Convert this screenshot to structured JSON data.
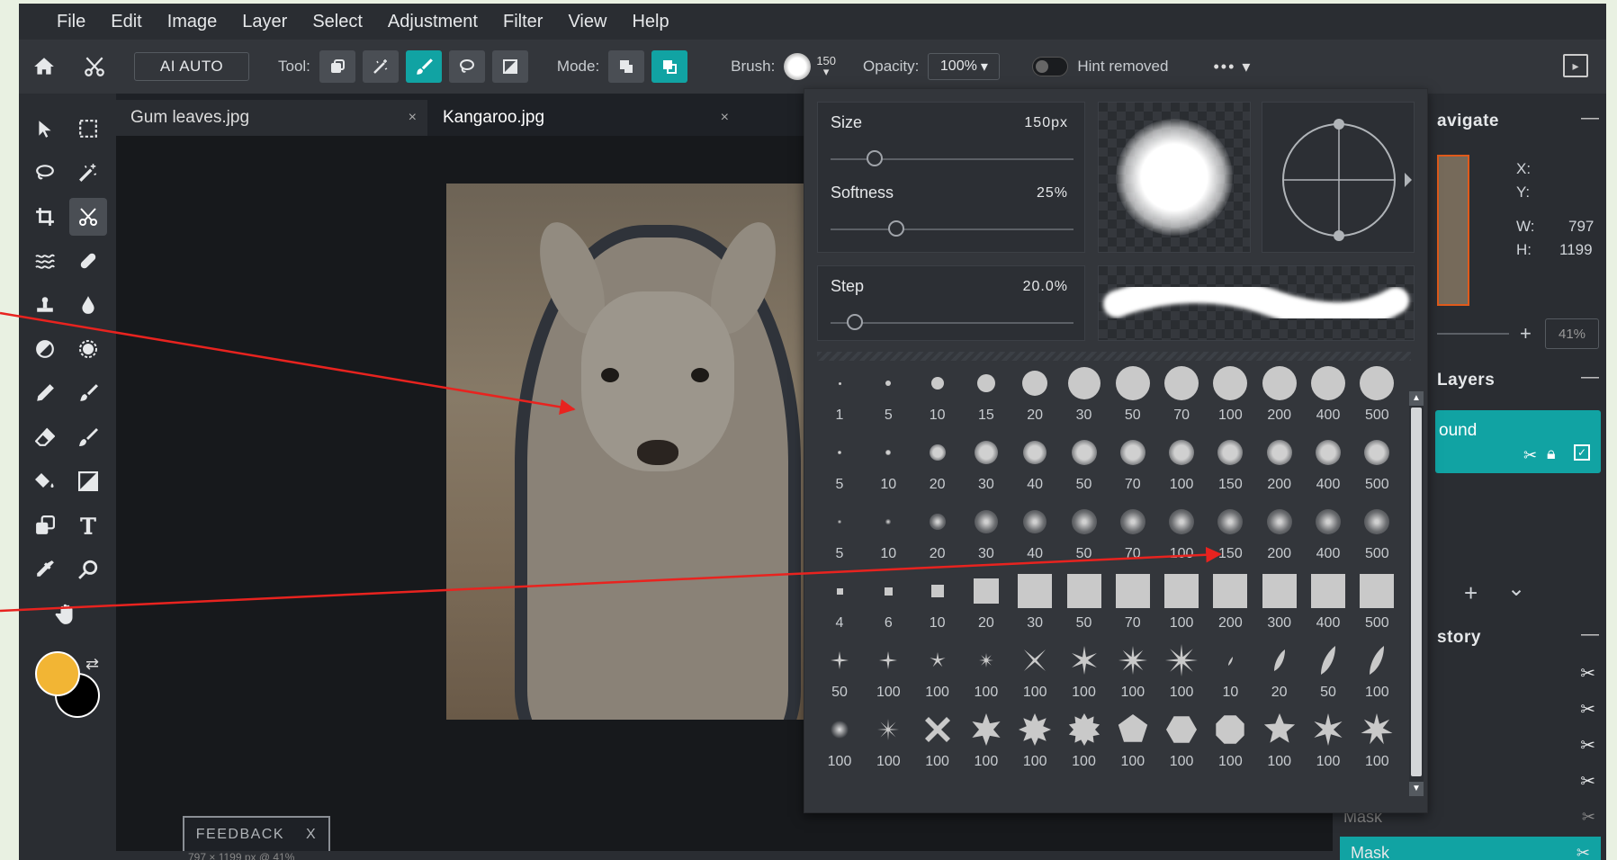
{
  "menu": [
    "File",
    "Edit",
    "Image",
    "Layer",
    "Select",
    "Adjustment",
    "Filter",
    "View",
    "Help"
  ],
  "optionsbar": {
    "ai_label": "AI AUTO",
    "tool_label": "Tool:",
    "mode_label": "Mode:",
    "brush_label": "Brush:",
    "brush_size": "150",
    "opacity_label": "Opacity:",
    "opacity_value": "100%",
    "hint_label": "Hint removed",
    "more": "•••"
  },
  "tabs": [
    {
      "label": "Gum leaves.jpg",
      "close": "×"
    },
    {
      "label": "Kangaroo.jpg",
      "close": "×"
    }
  ],
  "brush_panel": {
    "size_label": "Size",
    "size_value": "150px",
    "size_fraction": 0.18,
    "softness_label": "Softness",
    "softness_value": "25%",
    "softness_fraction": 0.27,
    "step_label": "Step",
    "step_value": "20.0%",
    "step_fraction": 0.1,
    "presets": [
      {
        "kind": "round-hard",
        "sizes": [
          "1",
          "5",
          "10",
          "15",
          "20",
          "30",
          "50",
          "70",
          "100",
          "200",
          "400",
          "500"
        ]
      },
      {
        "kind": "round-soft",
        "sizes": [
          "5",
          "10",
          "20",
          "30",
          "40",
          "50",
          "70",
          "100",
          "150",
          "200",
          "400",
          "500"
        ]
      },
      {
        "kind": "round-softer",
        "sizes": [
          "5",
          "10",
          "20",
          "30",
          "40",
          "50",
          "70",
          "100",
          "150",
          "200",
          "400",
          "500"
        ]
      },
      {
        "kind": "square",
        "sizes": [
          "4",
          "6",
          "10",
          "20",
          "30",
          "50",
          "70",
          "100",
          "200",
          "300",
          "400",
          "500"
        ]
      },
      {
        "kind": "star-leaf",
        "sizes": [
          "50",
          "100",
          "100",
          "100",
          "100",
          "100",
          "100",
          "100",
          "10",
          "20",
          "50",
          "100"
        ]
      },
      {
        "kind": "special",
        "sizes": [
          "100",
          "100",
          "100",
          "100",
          "100",
          "100",
          "100",
          "100",
          "100",
          "100",
          "100",
          "100"
        ]
      }
    ]
  },
  "navigate": {
    "title": "avigate",
    "x_label": "X:",
    "y_label": "Y:",
    "w_label": "W:",
    "w_value": "797",
    "h_label": "H:",
    "h_value": "1199",
    "zoom_value": "41%",
    "zoom_plus": "+"
  },
  "layers": {
    "title": "Layers",
    "layer_name": "ound",
    "add": "+",
    "expand": "⌄"
  },
  "history": {
    "title": "story",
    "mask_items": [
      "Mask",
      "Mask"
    ]
  },
  "feedback": {
    "label": "FEEDBACK",
    "close": "X"
  },
  "statusbar": {
    "text": "797 × 1199 px @ 41%"
  },
  "colors": {
    "accent": "#11a3a3",
    "foreground": "#f2b534",
    "background": "#000000"
  },
  "minimize": "—"
}
